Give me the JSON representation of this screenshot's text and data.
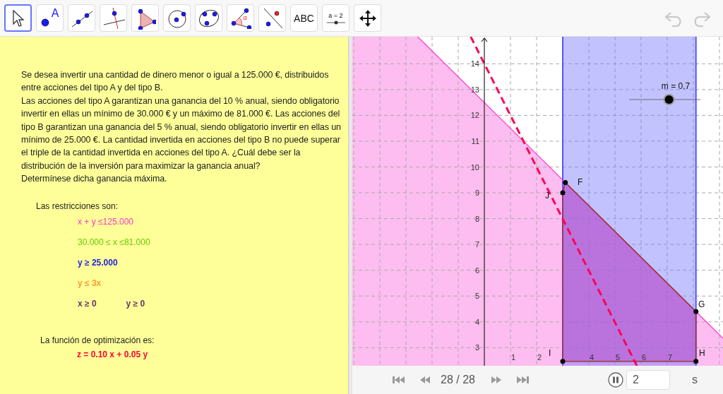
{
  "toolbar": {
    "tools": [
      {
        "kind": "move",
        "selected": true
      },
      {
        "kind": "point",
        "selected": false,
        "label": "A"
      },
      {
        "kind": "line",
        "selected": false
      },
      {
        "kind": "perpendicular",
        "selected": false
      },
      {
        "kind": "polygon",
        "selected": false
      },
      {
        "kind": "circle",
        "selected": false
      },
      {
        "kind": "conic",
        "selected": false
      },
      {
        "kind": "angle",
        "selected": false,
        "label": "α"
      },
      {
        "kind": "reflect",
        "selected": false
      },
      {
        "kind": "text",
        "selected": false,
        "label": "ABC"
      },
      {
        "kind": "slider",
        "selected": false,
        "label": "a = 2"
      },
      {
        "kind": "move_view",
        "selected": false
      }
    ],
    "undo_disabled": true,
    "redo_disabled": true
  },
  "problem": {
    "paragraphs": [
      "Se desea invertir una cantidad de dinero menor o igual a 125.000 €, distribuidos entre acciones del tipo A y del tipo B.",
      "Las acciones del tipo A garantizan una ganancia del 10 % anual, siendo obligatorio invertir en ellas un mínimo de 30.000 € y un máximo de 81.000 €. Las acciones del tipo B garantizan una ganancia del 5 % anual, siendo obligatorio invertir en ellas un mínimo de 25.000 €. La cantidad invertida en acciones del tipo B no puede superar el triple de la cantidad invertida en acciones del tipo A. ¿Cuál debe ser la distribución de la inversión para maximizar la ganancia anual?",
      "Determínese dicha ganancia máxima."
    ],
    "constraints_heading": "Las restricciones son:",
    "constraints": [
      {
        "texts": [
          "x + y ≤125.000"
        ],
        "color": "#ff33cc",
        "bold": false
      },
      {
        "texts": [
          "30.000 ≤ x  ≤81.000"
        ],
        "color": "#66cc00",
        "bold": false
      },
      {
        "texts": [
          "y ≥ 25.000"
        ],
        "color": "#2222dd",
        "bold": true
      },
      {
        "texts": [
          "y ≤ 3x"
        ],
        "color": "#ff9933",
        "bold": true
      },
      {
        "texts": [
          "x ≥ 0",
          "y ≥ 0"
        ],
        "color": "#663366",
        "bold": true
      }
    ],
    "objective_heading": "La función de optimización es:",
    "objective": {
      "text": "z = 0.10 x + 0.05 y",
      "color": "#ff0033"
    }
  },
  "graph": {
    "y_ticks": [
      "14",
      "13",
      "12",
      "11",
      "10",
      "9",
      "8",
      "7",
      "6",
      "5",
      "4",
      "3"
    ],
    "x_ticks": [
      "1",
      "2",
      "4",
      "5",
      "6",
      "7"
    ],
    "points": [
      "F",
      "J",
      "G",
      "I",
      "H"
    ],
    "slider": {
      "label": "m = 0.7",
      "level": 0.56
    }
  },
  "playback": {
    "position": "28 / 28",
    "playing": true,
    "speed": "2",
    "unit": "s"
  }
}
